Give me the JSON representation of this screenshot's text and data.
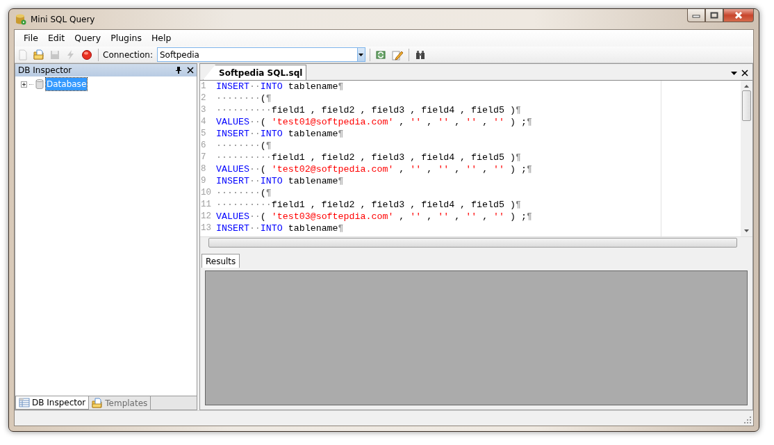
{
  "window": {
    "title": "Mini SQL Query"
  },
  "menu": [
    {
      "label": "File"
    },
    {
      "label": "Edit"
    },
    {
      "label": "Query"
    },
    {
      "label": "Plugins"
    },
    {
      "label": "Help"
    }
  ],
  "toolbar": {
    "left_buttons": [
      {
        "kind": "new",
        "disabled": true
      },
      {
        "kind": "open",
        "disabled": false
      },
      {
        "kind": "save",
        "disabled": true
      },
      {
        "kind": "execute",
        "disabled": true
      },
      {
        "kind": "stop",
        "disabled": false
      }
    ],
    "connection_label": "Connection:",
    "connection_value": "Softpedia",
    "right_buttons": [
      {
        "kind": "refresh",
        "disabled": false
      },
      {
        "kind": "edit",
        "disabled": false
      },
      {
        "kind": "find",
        "disabled": false
      }
    ]
  },
  "db_inspector": {
    "title": "DB Inspector",
    "tree": [
      {
        "label": "Database",
        "selected": true,
        "expanded": false
      }
    ],
    "tabs": [
      {
        "label": "DB Inspector",
        "kind": "inspector",
        "selected": true
      },
      {
        "label": "Templates",
        "kind": "templates",
        "selected": false
      }
    ]
  },
  "editor": {
    "tab": "Softpedia SQL.sql",
    "lines": [
      {
        "number": "1",
        "tokens": [
          {
            "kind": "keyword",
            "text": "INSERT"
          },
          {
            "kind": "space",
            "text": "··"
          },
          {
            "kind": "keyword",
            "text": "INTO"
          },
          {
            "kind": "plain",
            "text": " tablename"
          },
          {
            "kind": "eol",
            "text": "¶"
          }
        ]
      },
      {
        "number": "2",
        "tokens": [
          {
            "kind": "space",
            "text": "········"
          },
          {
            "kind": "plain",
            "text": "("
          },
          {
            "kind": "eol",
            "text": "¶"
          }
        ]
      },
      {
        "number": "3",
        "tokens": [
          {
            "kind": "space",
            "text": "··········"
          },
          {
            "kind": "plain",
            "text": "field1 , field2 , field3 , field4 , field5 )"
          },
          {
            "kind": "eol",
            "text": "¶"
          }
        ]
      },
      {
        "number": "4",
        "tokens": [
          {
            "kind": "keyword",
            "text": "VALUES"
          },
          {
            "kind": "space",
            "text": "··"
          },
          {
            "kind": "plain",
            "text": "( "
          },
          {
            "kind": "string",
            "text": "'test01@softpedia.com'"
          },
          {
            "kind": "plain",
            "text": " , "
          },
          {
            "kind": "string",
            "text": "''"
          },
          {
            "kind": "plain",
            "text": " , "
          },
          {
            "kind": "string",
            "text": "''"
          },
          {
            "kind": "plain",
            "text": " , "
          },
          {
            "kind": "string",
            "text": "''"
          },
          {
            "kind": "plain",
            "text": " , "
          },
          {
            "kind": "string",
            "text": "''"
          },
          {
            "kind": "plain",
            "text": " ) ;"
          },
          {
            "kind": "eol",
            "text": "¶"
          }
        ]
      },
      {
        "number": "5",
        "tokens": [
          {
            "kind": "keyword",
            "text": "INSERT"
          },
          {
            "kind": "space",
            "text": "··"
          },
          {
            "kind": "keyword",
            "text": "INTO"
          },
          {
            "kind": "plain",
            "text": " tablename"
          },
          {
            "kind": "eol",
            "text": "¶"
          }
        ]
      },
      {
        "number": "6",
        "tokens": [
          {
            "kind": "space",
            "text": "········"
          },
          {
            "kind": "plain",
            "text": "("
          },
          {
            "kind": "eol",
            "text": "¶"
          }
        ]
      },
      {
        "number": "7",
        "tokens": [
          {
            "kind": "space",
            "text": "··········"
          },
          {
            "kind": "plain",
            "text": "field1 , field2 , field3 , field4 , field5 )"
          },
          {
            "kind": "eol",
            "text": "¶"
          }
        ]
      },
      {
        "number": "8",
        "tokens": [
          {
            "kind": "keyword",
            "text": "VALUES"
          },
          {
            "kind": "space",
            "text": "··"
          },
          {
            "kind": "plain",
            "text": "( "
          },
          {
            "kind": "string",
            "text": "'test02@softpedia.com'"
          },
          {
            "kind": "plain",
            "text": " , "
          },
          {
            "kind": "string",
            "text": "''"
          },
          {
            "kind": "plain",
            "text": " , "
          },
          {
            "kind": "string",
            "text": "''"
          },
          {
            "kind": "plain",
            "text": " , "
          },
          {
            "kind": "string",
            "text": "''"
          },
          {
            "kind": "plain",
            "text": " , "
          },
          {
            "kind": "string",
            "text": "''"
          },
          {
            "kind": "plain",
            "text": " ) ;"
          },
          {
            "kind": "eol",
            "text": "¶"
          }
        ]
      },
      {
        "number": "9",
        "tokens": [
          {
            "kind": "keyword",
            "text": "INSERT"
          },
          {
            "kind": "space",
            "text": "··"
          },
          {
            "kind": "keyword",
            "text": "INTO"
          },
          {
            "kind": "plain",
            "text": " tablename"
          },
          {
            "kind": "eol",
            "text": "¶"
          }
        ]
      },
      {
        "number": "10",
        "tokens": [
          {
            "kind": "space",
            "text": "········"
          },
          {
            "kind": "plain",
            "text": "("
          },
          {
            "kind": "eol",
            "text": "¶"
          }
        ]
      },
      {
        "number": "11",
        "tokens": [
          {
            "kind": "space",
            "text": "··········"
          },
          {
            "kind": "plain",
            "text": "field1 , field2 , field3 , field4 , field5 )"
          },
          {
            "kind": "eol",
            "text": "¶"
          }
        ]
      },
      {
        "number": "12",
        "tokens": [
          {
            "kind": "keyword",
            "text": "VALUES"
          },
          {
            "kind": "space",
            "text": "··"
          },
          {
            "kind": "plain",
            "text": "( "
          },
          {
            "kind": "string",
            "text": "'test03@softepdia.com'"
          },
          {
            "kind": "plain",
            "text": " , "
          },
          {
            "kind": "string",
            "text": "''"
          },
          {
            "kind": "plain",
            "text": " , "
          },
          {
            "kind": "string",
            "text": "''"
          },
          {
            "kind": "plain",
            "text": " , "
          },
          {
            "kind": "string",
            "text": "''"
          },
          {
            "kind": "plain",
            "text": " , "
          },
          {
            "kind": "string",
            "text": "''"
          },
          {
            "kind": "plain",
            "text": " ) ;"
          },
          {
            "kind": "eol",
            "text": "¶"
          }
        ]
      },
      {
        "number": "13",
        "tokens": [
          {
            "kind": "keyword",
            "text": "INSERT"
          },
          {
            "kind": "space",
            "text": "··"
          },
          {
            "kind": "keyword",
            "text": "INTO"
          },
          {
            "kind": "plain",
            "text": " tablename"
          },
          {
            "kind": "eol",
            "text": "¶"
          }
        ]
      }
    ]
  },
  "results": {
    "tabs": [
      {
        "label": "Results",
        "selected": true
      }
    ]
  }
}
